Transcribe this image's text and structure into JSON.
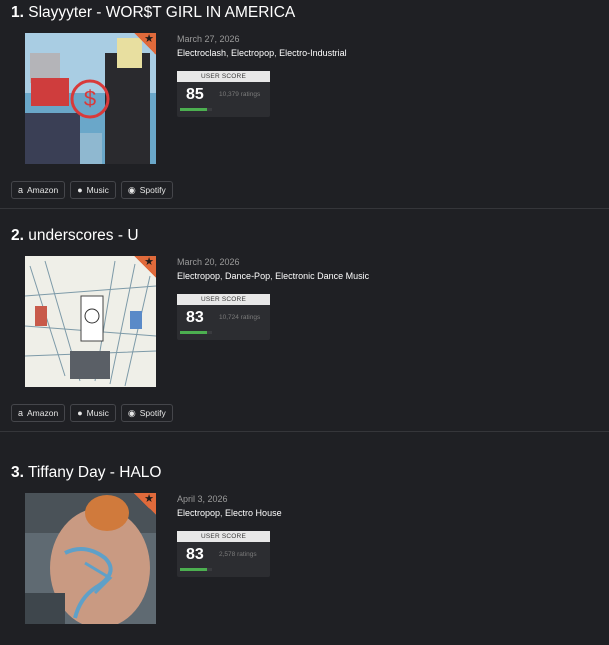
{
  "entries": [
    {
      "rank": "1.",
      "title": "Slayyyter - WOR$T GIRL IN AMERICA",
      "date": "March 27, 2026",
      "genres": [
        "Electroclash",
        "Electropop",
        "Electro-Industrial"
      ],
      "score_label": "USER SCORE",
      "score": "85",
      "score_fraction": 0.85,
      "ratings": "10,379 ratings",
      "buttons": [
        "Amazon",
        "Music",
        "Spotify"
      ],
      "cover_text": "$"
    },
    {
      "rank": "2.",
      "title": "underscores - U",
      "date": "March 20, 2026",
      "genres": [
        "Electropop",
        "Dance-Pop",
        "Electronic Dance Music"
      ],
      "score_label": "USER SCORE",
      "score": "83",
      "score_fraction": 0.83,
      "ratings": "10,724 ratings",
      "buttons": [
        "Amazon",
        "Music",
        "Spotify"
      ]
    },
    {
      "rank": "3.",
      "title": "Tiffany Day - HALO",
      "date": "April 3, 2026",
      "genres": [
        "Electropop",
        "Electro House"
      ],
      "score_label": "USER SCORE",
      "score": "83",
      "score_fraction": 0.83,
      "ratings": "2,578 ratings"
    }
  ],
  "icons": {
    "amazon": "amazon-icon",
    "music": "apple-icon",
    "spotify": "spotify-icon",
    "corner": "star-icon"
  },
  "colors": {
    "background": "#1f2024",
    "accent": "#e06a3b",
    "score_bar": "#4caf50"
  }
}
